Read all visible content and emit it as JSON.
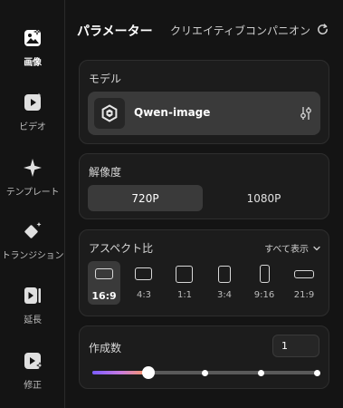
{
  "sidebar": {
    "items": [
      {
        "label": "画像",
        "icon": "image-icon",
        "active": true
      },
      {
        "label": "ビデオ",
        "icon": "video-icon",
        "active": false
      },
      {
        "label": "テンプレート",
        "icon": "sparkle-icon",
        "active": false
      },
      {
        "label": "トランジション",
        "icon": "transition-icon",
        "active": false
      },
      {
        "label": "延長",
        "icon": "extend-icon",
        "active": false
      },
      {
        "label": "修正",
        "icon": "edit-icon",
        "active": false
      }
    ]
  },
  "header": {
    "tab_active": "パラメーター",
    "tab_other": "クリエイティブコンパニオン",
    "refresh_icon": "refresh-icon"
  },
  "model": {
    "title": "モデル",
    "selected": "Qwen-image",
    "adjust_icon": "sliders-icon"
  },
  "resolution": {
    "title": "解像度",
    "options": [
      "720P",
      "1080P"
    ],
    "selected": "720P"
  },
  "aspect": {
    "title": "アスペクト比",
    "show_all": "すべて表示",
    "options": [
      "16:9",
      "4:3",
      "1:1",
      "3:4",
      "9:16",
      "21:9"
    ],
    "selected": "16:9"
  },
  "count": {
    "title": "作成数",
    "value": "1",
    "slider_steps": 4,
    "slider_value_index": 0
  },
  "colors": {
    "background": "#141414",
    "card": "#1c1c1c",
    "selected": "#3a3a3a",
    "slider_gradient": [
      "#7b5cff",
      "#c77ae0",
      "#ff9a5a"
    ]
  }
}
